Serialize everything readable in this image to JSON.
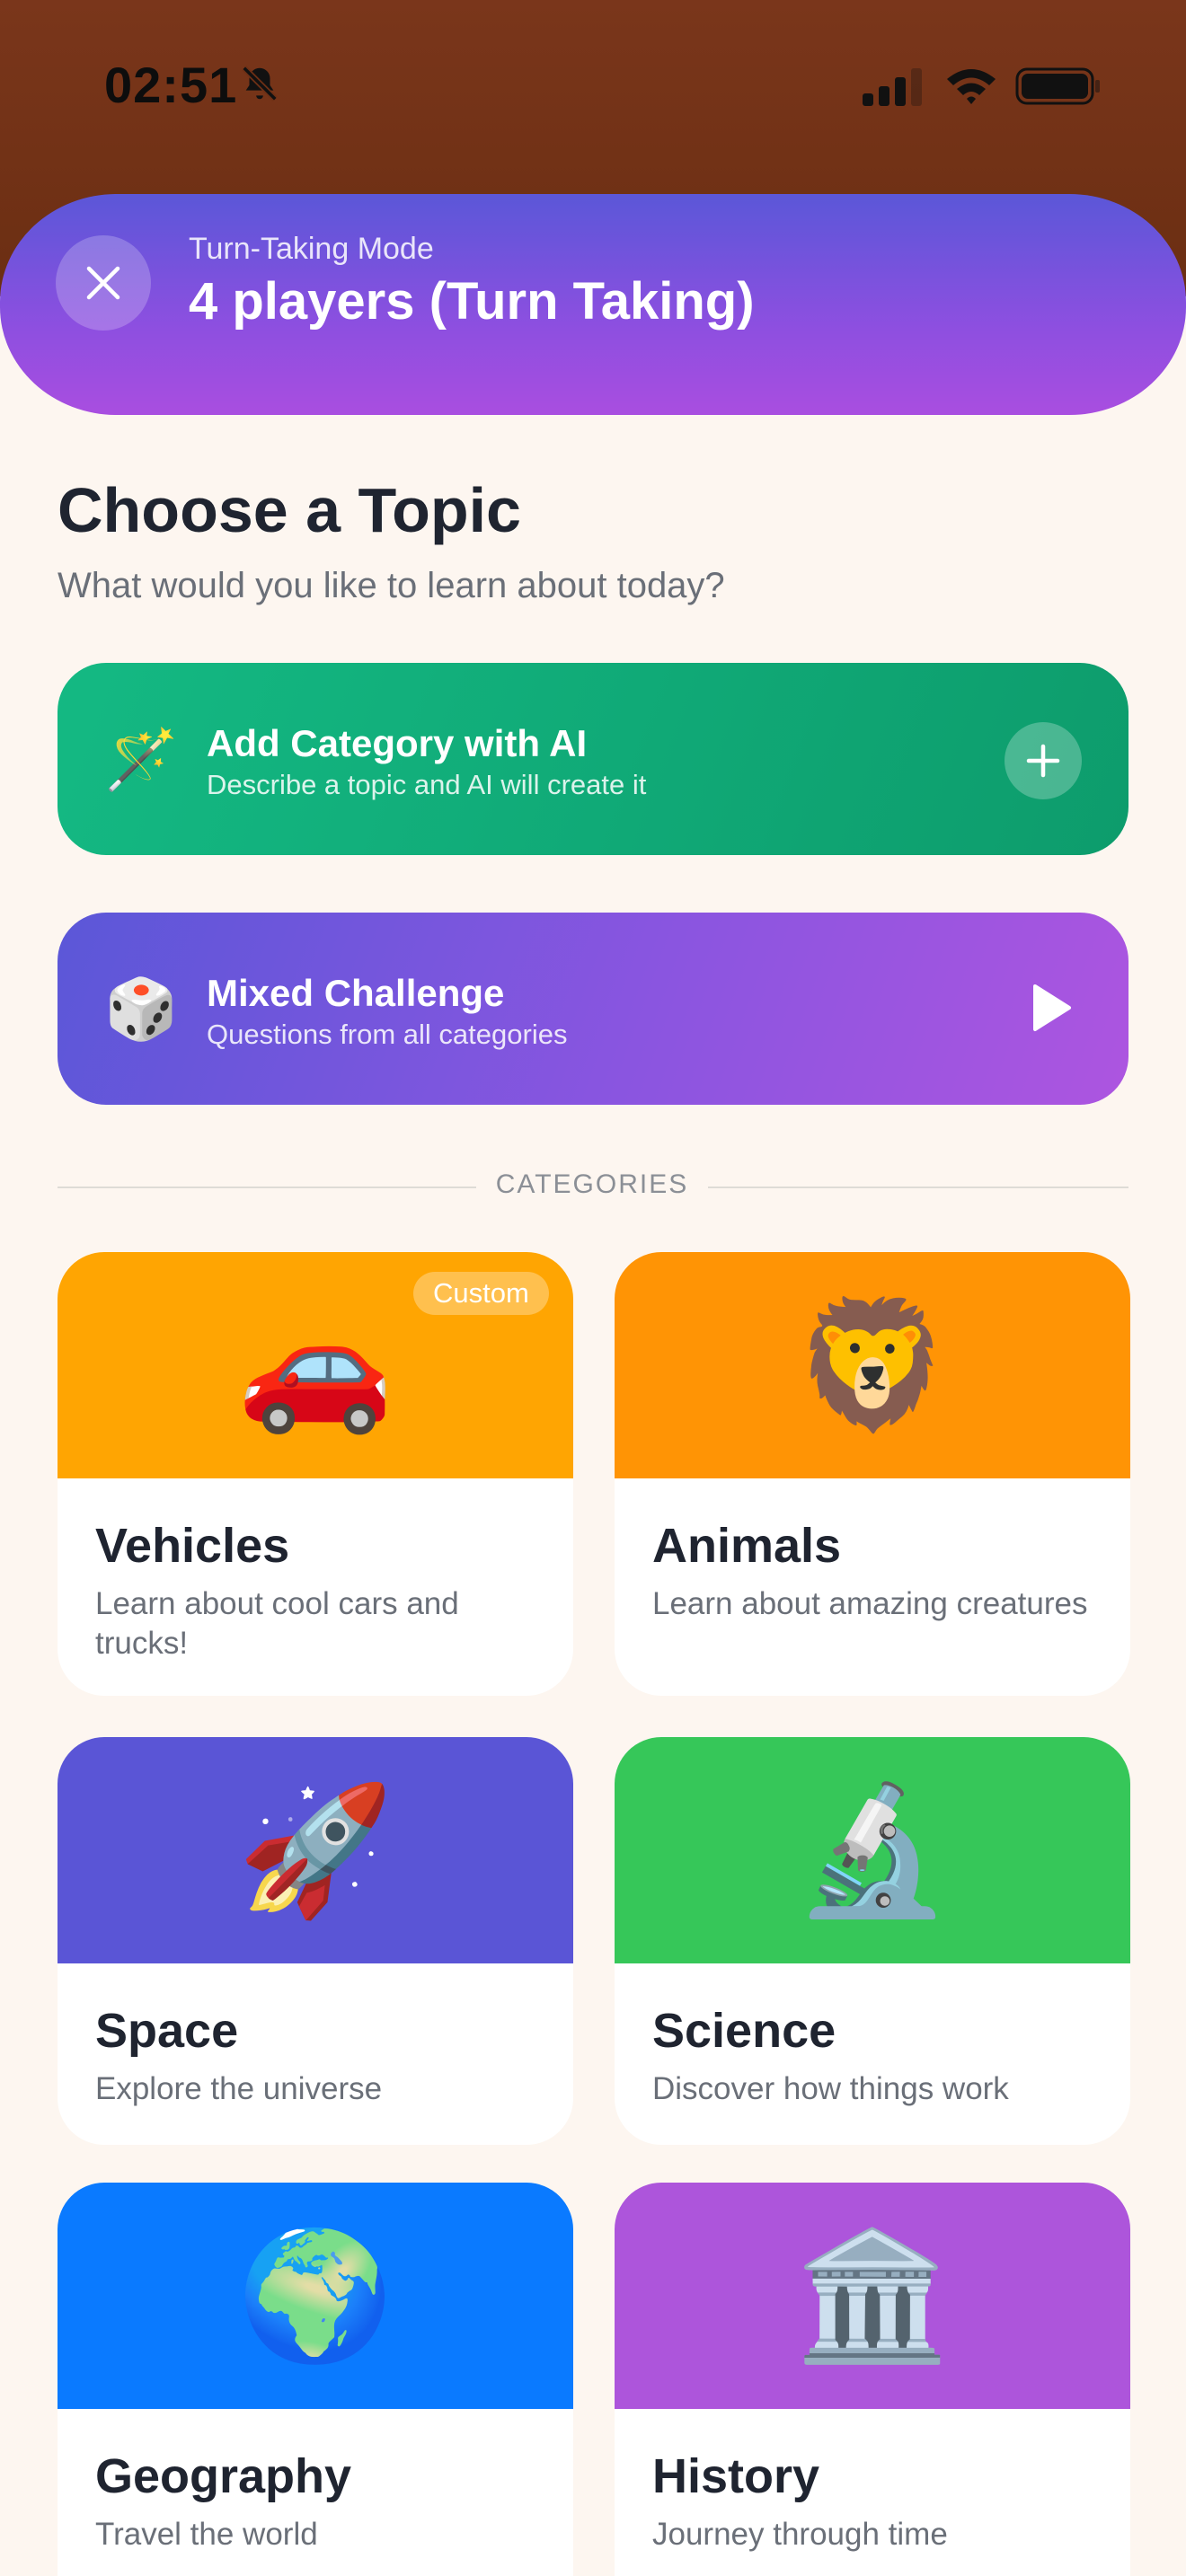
{
  "status_bar": {
    "time": "02:51"
  },
  "mode_header": {
    "label": "Turn-Taking Mode",
    "title": "4 players (Turn Taking)"
  },
  "page": {
    "title": "Choose a Topic",
    "subtitle": "What would you like to learn about today?"
  },
  "ai_card": {
    "emoji": "🪄",
    "title": "Add Category with AI",
    "description": "Describe a topic and AI will create it"
  },
  "mixed_card": {
    "emoji": "🎲",
    "title": "Mixed Challenge",
    "description": "Questions from all categories"
  },
  "categories_heading": "CATEGORIES",
  "categories": [
    {
      "name": "Vehicles",
      "description": "Learn about cool cars and trucks!",
      "emoji": "🚗",
      "badge": "Custom",
      "color": "#ffa502"
    },
    {
      "name": "Animals",
      "description": "Learn about amazing creatures",
      "emoji": "🦁",
      "color": "#ff9405"
    },
    {
      "name": "Space",
      "description": "Explore the universe",
      "emoji": "🚀",
      "color": "#5a55d6"
    },
    {
      "name": "Science",
      "description": "Discover how things work",
      "emoji": "🔬",
      "color": "#36c759"
    },
    {
      "name": "Geography",
      "description": "Travel the world",
      "emoji": "🌍",
      "color": "#0a7aff"
    },
    {
      "name": "History",
      "description": "Journey through time",
      "emoji": "🏛️",
      "color": "#ad55db"
    }
  ],
  "icons": {
    "close": "close-icon",
    "plus": "plus-icon",
    "play": "play-icon",
    "bell_off": "bell-slash-icon",
    "signal": "cellular-signal-icon",
    "wifi": "wifi-icon",
    "battery": "battery-icon"
  },
  "colors": {
    "status_bg": "#6f3015",
    "header_start": "#5b57d8",
    "header_end": "#a94ee0",
    "ai_green": "#11a977",
    "page_bg": "#fdf6f0"
  }
}
